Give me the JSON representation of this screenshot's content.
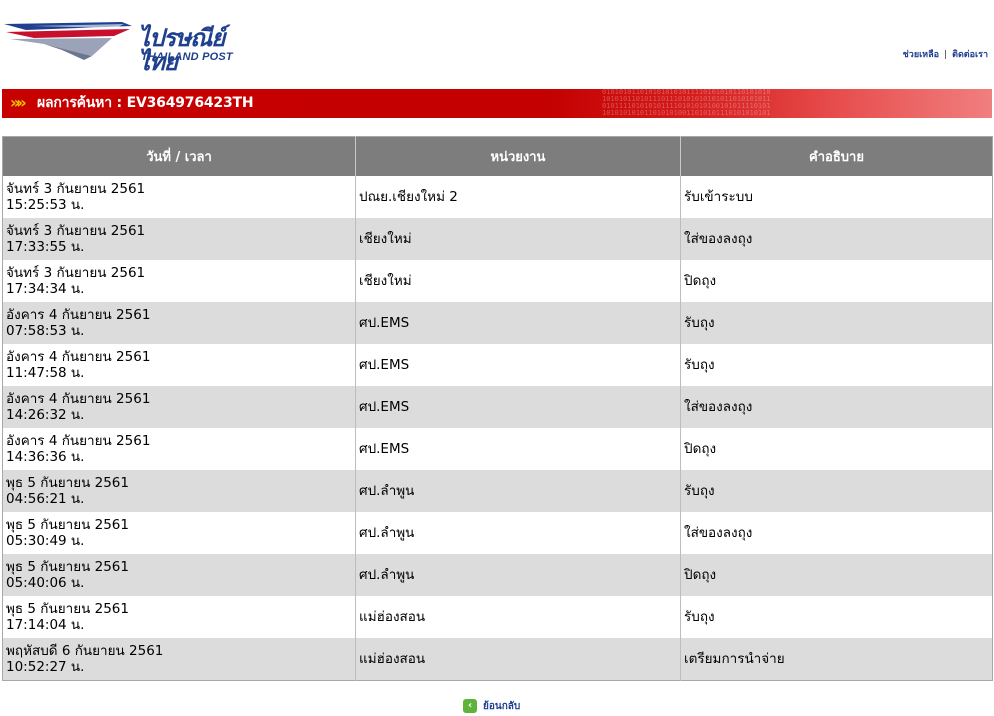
{
  "brand": {
    "logo_thai": "ไปรษณีย์ไทย",
    "logo_english": "THAILAND POST"
  },
  "top_links": {
    "help": "ช่วยเหลือ",
    "separator": "|",
    "contact": "ติดต่อเรา"
  },
  "result": {
    "arrows": "»",
    "label": "ผลการค้นหา : EV364976423TH",
    "binary_pattern": "0101010110101010101011110101010110101010\n1010101101011101110101010101011010101011\n0101111010101011110101010100101011110101\n1010101010110101010011010101110101010101"
  },
  "table": {
    "headers": {
      "datetime": "วันที่ / เวลา",
      "office": "หน่วยงาน",
      "description": "คำอธิบาย"
    },
    "rows": [
      {
        "date": "จันทร์ 3 กันยายน 2561",
        "time": "15:25:53 น.",
        "office": "ปณย.เชียงใหม่ 2",
        "description": "รับเข้าระบบ"
      },
      {
        "date": "จันทร์ 3 กันยายน 2561",
        "time": "17:33:55 น.",
        "office": "เชียงใหม่",
        "description": "ใส่ของลงถุง"
      },
      {
        "date": "จันทร์ 3 กันยายน 2561",
        "time": "17:34:34 น.",
        "office": "เชียงใหม่",
        "description": "ปิดถุง"
      },
      {
        "date": "อังคาร 4 กันยายน 2561",
        "time": "07:58:53 น.",
        "office": "ศป.EMS",
        "description": "รับถุง"
      },
      {
        "date": "อังคาร 4 กันยายน 2561",
        "time": "11:47:58 น.",
        "office": "ศป.EMS",
        "description": "รับถุง"
      },
      {
        "date": "อังคาร 4 กันยายน 2561",
        "time": "14:26:32 น.",
        "office": "ศป.EMS",
        "description": "ใส่ของลงถุง"
      },
      {
        "date": "อังคาร 4 กันยายน 2561",
        "time": "14:36:36 น.",
        "office": "ศป.EMS",
        "description": "ปิดถุง"
      },
      {
        "date": "พุธ 5 กันยายน 2561",
        "time": "04:56:21 น.",
        "office": "ศป.ลำพูน",
        "description": "รับถุง"
      },
      {
        "date": "พุธ 5 กันยายน 2561",
        "time": "05:30:49 น.",
        "office": "ศป.ลำพูน",
        "description": "ใส่ของลงถุง"
      },
      {
        "date": "พุธ 5 กันยายน 2561",
        "time": "05:40:06 น.",
        "office": "ศป.ลำพูน",
        "description": "ปิดถุง"
      },
      {
        "date": "พุธ 5 กันยายน 2561",
        "time": "17:14:04 น.",
        "office": "แม่ฮ่องสอน",
        "description": "รับถุง"
      },
      {
        "date": "พฤหัสบดี 6 กันยายน 2561",
        "time": "10:52:27 น.",
        "office": "แม่ฮ่องสอน",
        "description": "เตรียมการนำจ่าย"
      }
    ]
  },
  "back": {
    "icon": "back-arrow-icon",
    "label": "ย้อนกลับ"
  },
  "colors": {
    "brand_blue": "#1f3f8f",
    "banner_red": "#c70000",
    "header_gray": "#7d7d7d",
    "row_alt": "#dcdcdc"
  }
}
